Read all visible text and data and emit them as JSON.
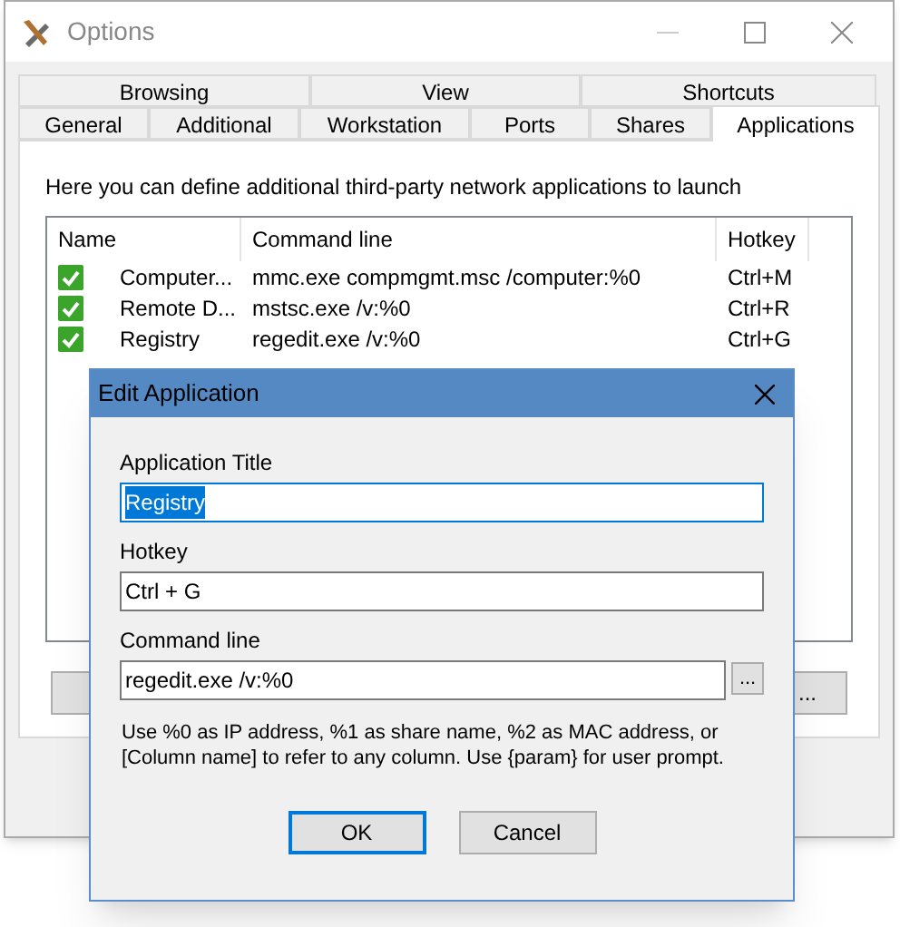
{
  "window": {
    "title": "Options"
  },
  "tab_rows": [
    [
      {
        "label": "Browsing",
        "selected": false
      },
      {
        "label": "View",
        "selected": false
      },
      {
        "label": "Shortcuts",
        "selected": false
      }
    ],
    [
      {
        "label": "General",
        "selected": false
      },
      {
        "label": "Additional",
        "selected": false
      },
      {
        "label": "Workstation",
        "selected": false
      },
      {
        "label": "Ports",
        "selected": false
      },
      {
        "label": "Shares",
        "selected": false
      },
      {
        "label": "Applications",
        "selected": true
      }
    ]
  ],
  "description": "Here you can define additional third-party network applications to launch",
  "list": {
    "columns": [
      "Name",
      "Command line",
      "Hotkey"
    ],
    "rows": [
      {
        "checked": true,
        "name": "Computer...",
        "command": "mmc.exe compmgmt.msc /computer:%0",
        "hotkey": "Ctrl+M"
      },
      {
        "checked": true,
        "name": "Remote D...",
        "command": "mstsc.exe /v:%0",
        "hotkey": "Ctrl+R"
      },
      {
        "checked": true,
        "name": "Registry",
        "command": "regedit.exe /v:%0",
        "hotkey": "Ctrl+G"
      }
    ]
  },
  "panel_buttons": [
    "..."
  ],
  "dialog": {
    "title": "Edit Application",
    "fields": [
      {
        "label": "Application Title",
        "value": "Registry",
        "focused": true,
        "text_selected": true,
        "kind": "text"
      },
      {
        "label": "Hotkey",
        "value": "Ctrl + G",
        "focused": false,
        "text_selected": false,
        "kind": "text"
      },
      {
        "label": "Command line",
        "value": "regedit.exe /v:%0",
        "focused": false,
        "text_selected": false,
        "kind": "browse",
        "browse_label": "..."
      }
    ],
    "hint": "Use %0 as IP address, %1 as share name, %2 as MAC address, or [Column name] to refer to any column. Use {param} for user prompt.",
    "buttons": [
      {
        "label": "OK",
        "default": true
      },
      {
        "label": "Cancel",
        "default": false
      }
    ]
  }
}
